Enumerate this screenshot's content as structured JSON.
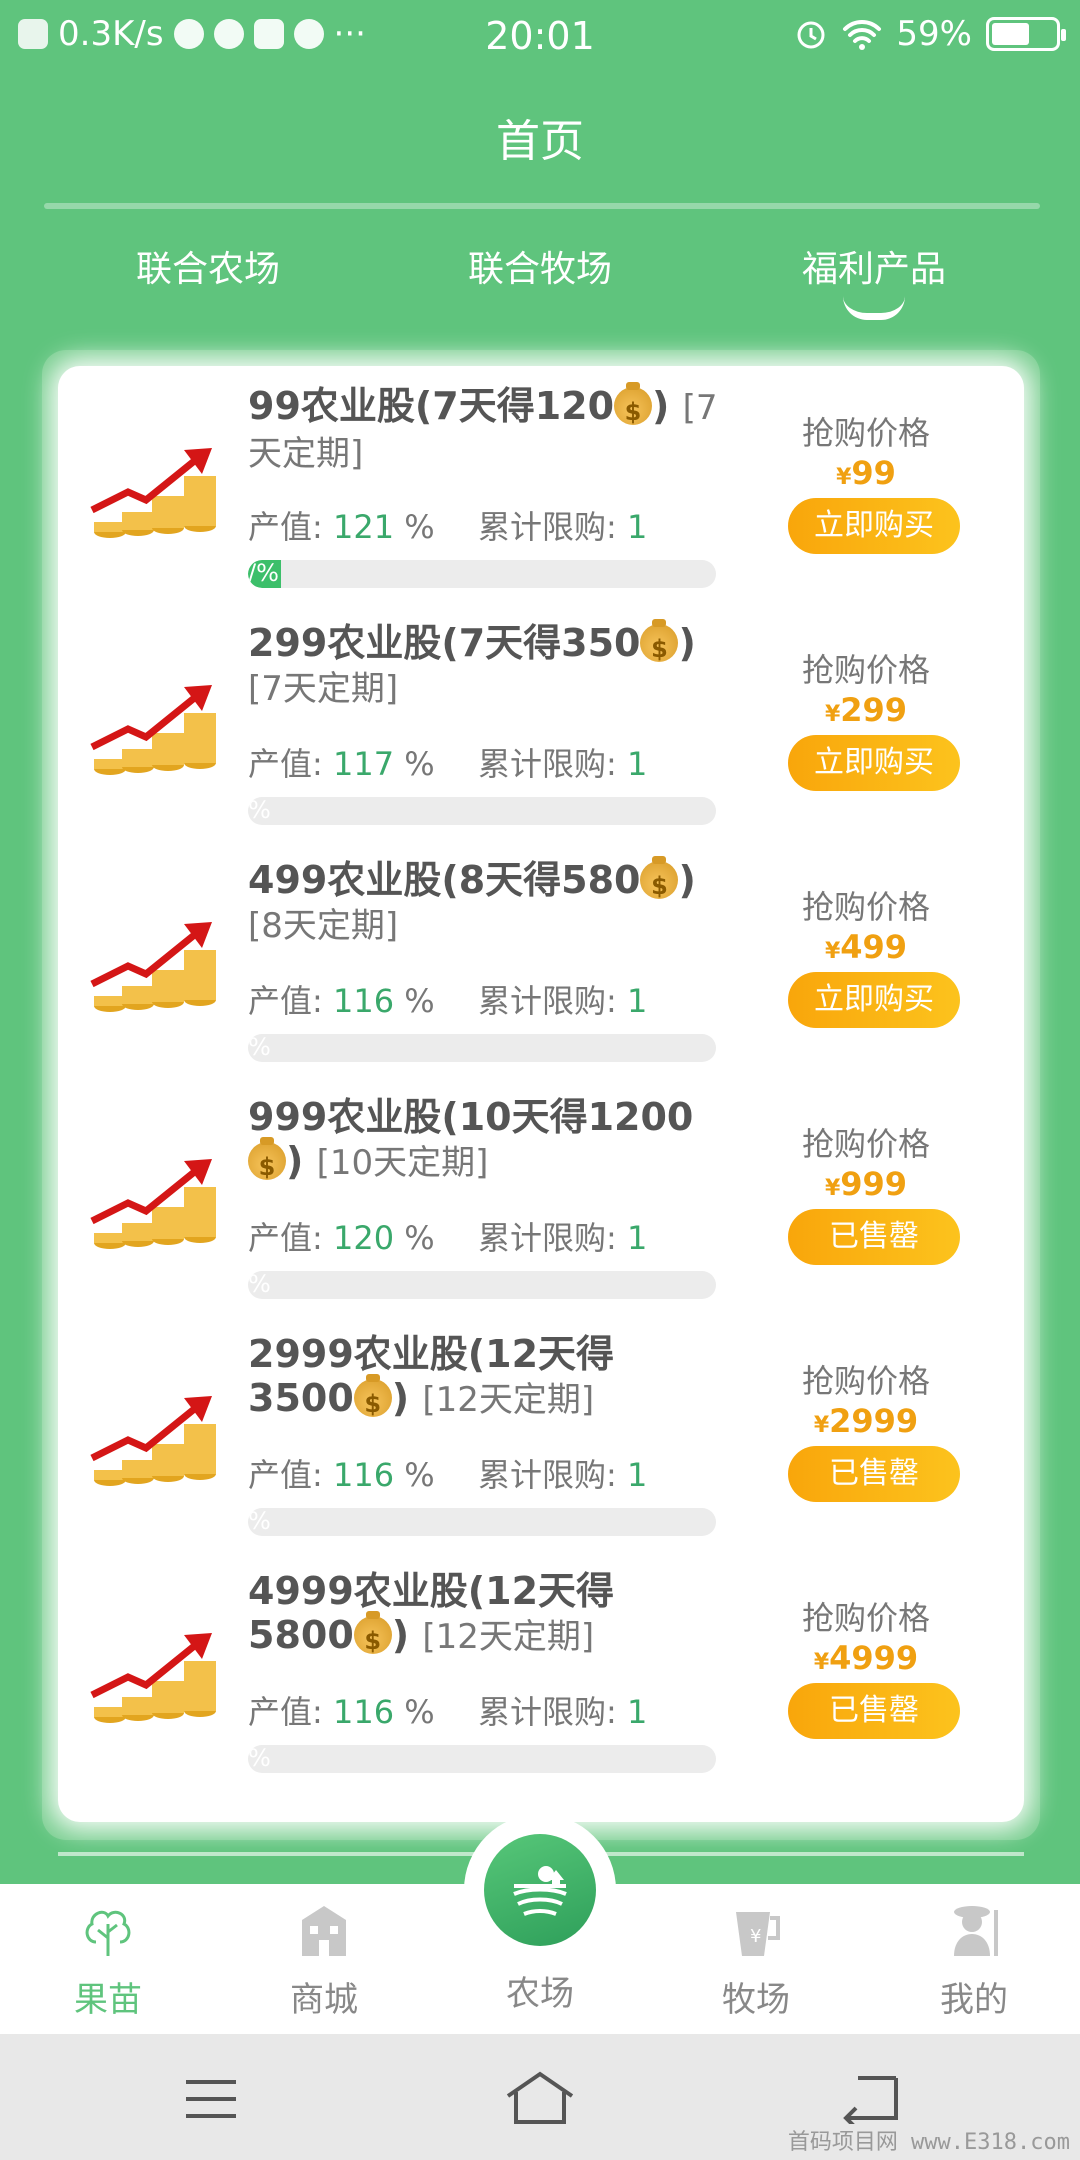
{
  "status_bar": {
    "speed": "0.3K/s",
    "more": "···",
    "time": "20:01",
    "battery_percent": "59%",
    "battery_level": 0.59
  },
  "header": {
    "title": "首页"
  },
  "tabs": [
    {
      "label": "联合农场",
      "active": false
    },
    {
      "label": "联合牧场",
      "active": false
    },
    {
      "label": "福利产品",
      "active": true
    }
  ],
  "products": [
    {
      "name": "99农业股(7天得120",
      "close": ")",
      "term": "[7天定期]",
      "output_label": "产值:",
      "output_value": "121",
      "output_unit": "%",
      "limit_label": "累计限购:",
      "limit_value": "1",
      "progress_text": "/%",
      "progress": 0.07,
      "price_label": "抢购价格",
      "currency": "¥",
      "price": "99",
      "button": "立即购买"
    },
    {
      "name": "299农业股(7天得350",
      "close": ")",
      "term": "[7天定期]",
      "output_label": "产值:",
      "output_value": "117",
      "output_unit": "%",
      "limit_label": "累计限购:",
      "limit_value": "1",
      "progress_text": "%",
      "progress": 0,
      "price_label": "抢购价格",
      "currency": "¥",
      "price": "299",
      "button": "立即购买"
    },
    {
      "name": "499农业股(8天得580",
      "close": ")",
      "term": "[8天定期]",
      "output_label": "产值:",
      "output_value": "116",
      "output_unit": "%",
      "limit_label": "累计限购:",
      "limit_value": "1",
      "progress_text": "%",
      "progress": 0,
      "price_label": "抢购价格",
      "currency": "¥",
      "price": "499",
      "button": "立即购买"
    },
    {
      "name": "999农业股(10天得1200",
      "close": ")",
      "term": "[10天定期]",
      "output_label": "产值:",
      "output_value": "120",
      "output_unit": "%",
      "limit_label": "累计限购:",
      "limit_value": "1",
      "progress_text": "%",
      "progress": 0,
      "price_label": "抢购价格",
      "currency": "¥",
      "price": "999",
      "button": "已售罄"
    },
    {
      "name": "2999农业股(12天得3500",
      "close": ")",
      "term": "[12天定期]",
      "output_label": "产值:",
      "output_value": "116",
      "output_unit": "%",
      "limit_label": "累计限购:",
      "limit_value": "1",
      "progress_text": "%",
      "progress": 0,
      "price_label": "抢购价格",
      "currency": "¥",
      "price": "2999",
      "button": "已售罄"
    },
    {
      "name": "4999农业股(12天得5800",
      "close": ")",
      "term": "[12天定期]",
      "output_label": "产值:",
      "output_value": "116",
      "output_unit": "%",
      "limit_label": "累计限购:",
      "limit_value": "1",
      "progress_text": "%",
      "progress": 0,
      "price_label": "抢购价格",
      "currency": "¥",
      "price": "4999",
      "button": "已售罄"
    }
  ],
  "bottom_nav": [
    {
      "label": "果苗",
      "icon": "tree-icon",
      "active": true
    },
    {
      "label": "商城",
      "icon": "store-icon",
      "active": false
    },
    {
      "label": "农场",
      "icon": "farm-icon",
      "active": false
    },
    {
      "label": "牧场",
      "icon": "ranch-icon",
      "active": false
    },
    {
      "label": "我的",
      "icon": "farmer-icon",
      "active": false
    }
  ],
  "watermark": "首码项目网 www.E318.com",
  "colors": {
    "brand_green": "#5fc47d",
    "price_orange": "#f0a011",
    "value_green": "#3aa86b"
  }
}
